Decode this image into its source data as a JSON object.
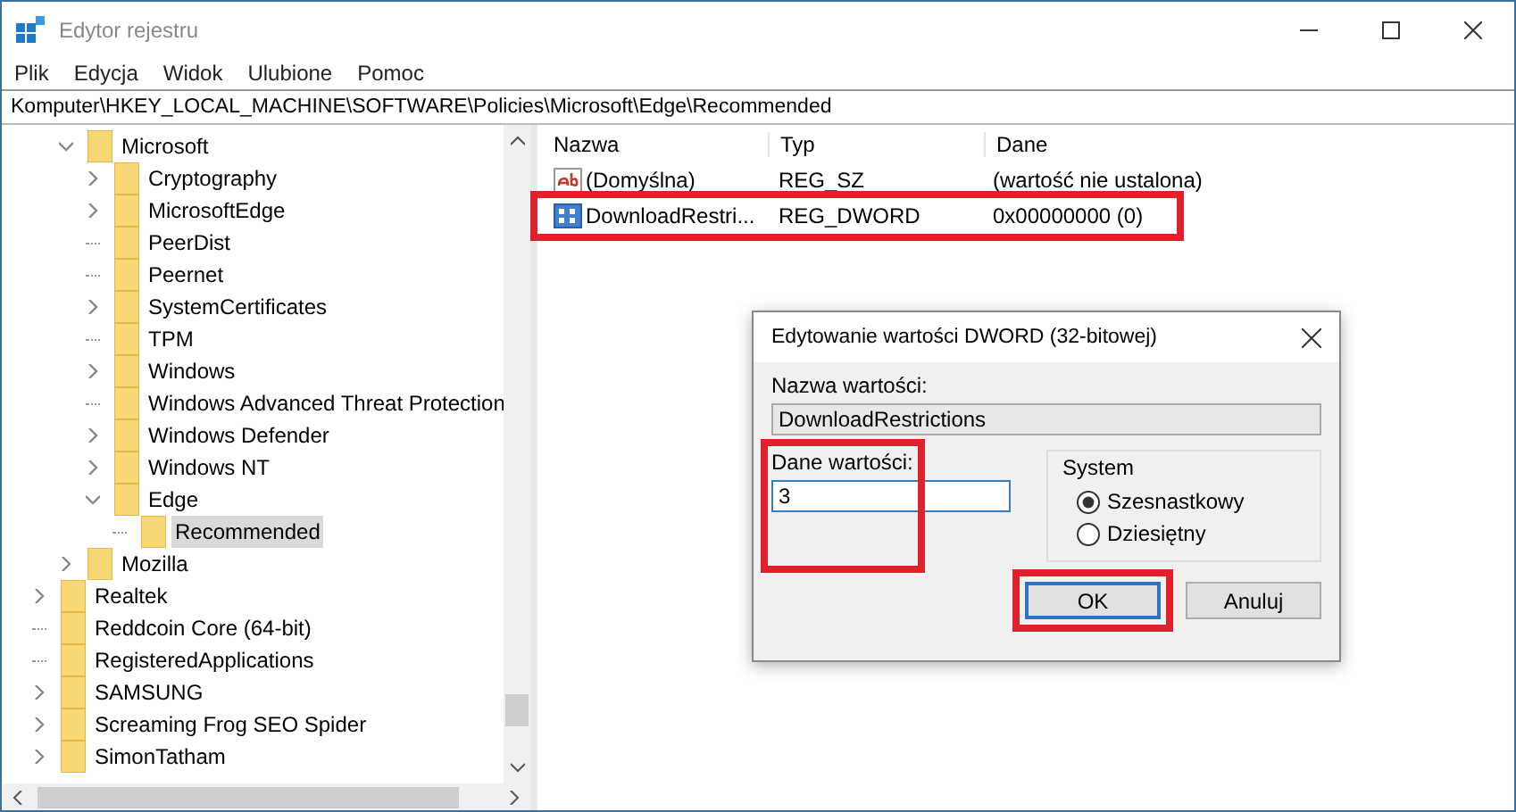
{
  "window": {
    "title": "Edytor rejestru"
  },
  "menu": [
    "Plik",
    "Edycja",
    "Widok",
    "Ulubione",
    "Pomoc"
  ],
  "address": "Komputer\\HKEY_LOCAL_MACHINE\\SOFTWARE\\Policies\\Microsoft\\Edge\\Recommended",
  "tree": {
    "items": [
      {
        "children": [
          {
            "label": "Microsoft",
            "expanded": true,
            "selected": false,
            "children": [
              {
                "label": "Cryptography",
                "expanded": false,
                "selected": false
              },
              {
                "label": "MicrosoftEdge",
                "expanded": false,
                "selected": false
              },
              {
                "label": "PeerDist",
                "selected": false
              },
              {
                "label": "Peernet",
                "selected": false
              },
              {
                "label": "SystemCertificates",
                "expanded": false,
                "selected": false
              },
              {
                "label": "TPM",
                "selected": false
              },
              {
                "label": "Windows",
                "expanded": false,
                "selected": false
              },
              {
                "label": "Windows Advanced Threat Protection",
                "selected": false
              },
              {
                "label": "Windows Defender",
                "expanded": false,
                "selected": false
              },
              {
                "label": "Windows NT",
                "expanded": false,
                "selected": false
              },
              {
                "label": "Edge",
                "expanded": true,
                "selected": false,
                "children": [
                  {
                    "label": "Recommended",
                    "selected": true
                  }
                ]
              }
            ]
          },
          {
            "label": "Mozilla",
            "expanded": false,
            "selected": false
          }
        ]
      },
      {
        "label": "Realtek",
        "expanded": false,
        "selected": false
      },
      {
        "label": "Reddcoin Core (64-bit)",
        "selected": false
      },
      {
        "label": "RegisteredApplications",
        "selected": false
      },
      {
        "label": "SAMSUNG",
        "expanded": false,
        "selected": false
      },
      {
        "label": "Screaming Frog SEO Spider",
        "expanded": false,
        "selected": false
      },
      {
        "label": "SimonTatham",
        "expanded": false,
        "selected": false
      }
    ]
  },
  "values": {
    "columns": [
      "Nazwa",
      "Typ",
      "Dane"
    ],
    "rows": [
      {
        "kind": "string",
        "name": "(Domyślna)",
        "type": "REG_SZ",
        "data": "(wartość nie ustalona)",
        "highlighted": false
      },
      {
        "kind": "dword",
        "name": "DownloadRestri...",
        "type": "REG_DWORD",
        "data": "0x00000000 (0)",
        "highlighted": true
      }
    ]
  },
  "dialog": {
    "title": "Edytowanie wartości DWORD (32-bitowej)",
    "name_label": "Nazwa wartości:",
    "name_value": "DownloadRestrictions",
    "data_label": "Dane wartości:",
    "data_value": "3",
    "data_highlighted": true,
    "system": {
      "title": "System",
      "options": [
        {
          "label": "Szesnastkowy",
          "selected": true
        },
        {
          "label": "Dziesiętny",
          "selected": false
        }
      ]
    },
    "buttons": [
      {
        "label": "OK",
        "default": true,
        "highlighted": true
      },
      {
        "label": "Anuluj",
        "default": false,
        "highlighted": false
      }
    ]
  }
}
